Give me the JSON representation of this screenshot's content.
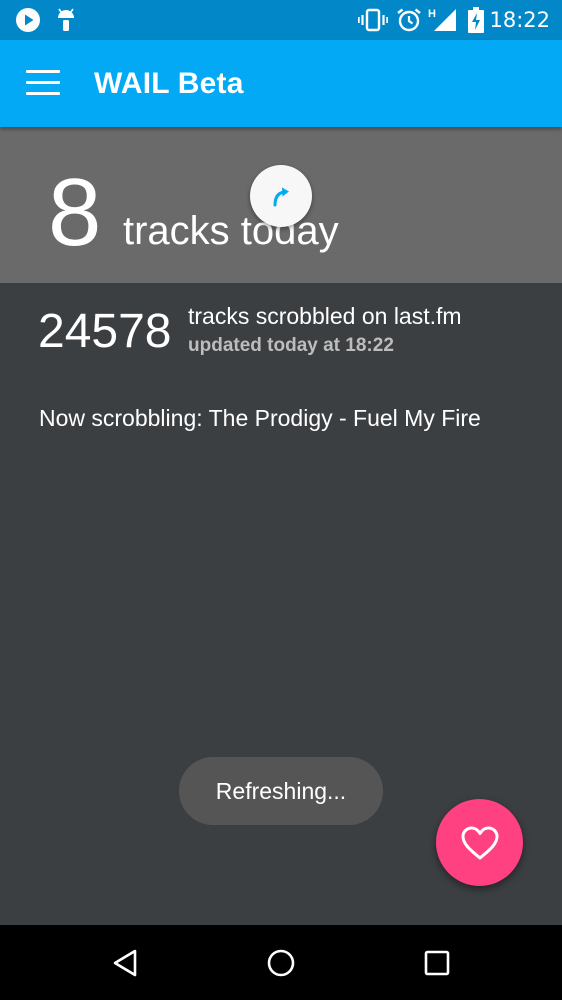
{
  "status_bar": {
    "time": "18:22",
    "icons": [
      "play-notification-icon",
      "android-debug-icon",
      "vibrate-icon",
      "alarm-icon",
      "signal-h-icon",
      "battery-charging-icon"
    ],
    "network_type": "H",
    "background": "#0288c9"
  },
  "app_bar": {
    "title": "WAIL Beta",
    "menu_icon": "hamburger-menu-icon",
    "background": "#03a9f4"
  },
  "today": {
    "count": "8",
    "label": "tracks today"
  },
  "refresh": {
    "icon": "refresh-arrow-icon",
    "color": "#03a9f4"
  },
  "stats": {
    "total": "24578",
    "total_label": "tracks scrobbled on last.fm",
    "updated": "updated today at 18:22"
  },
  "now_scrobbling": "Now scrobbling: The Prodigy - Fuel My Fire",
  "toast": "Refreshing...",
  "fab": {
    "icon": "heart-outline-icon",
    "color": "#ff4081"
  },
  "nav_bar": {
    "buttons": [
      "back-icon",
      "home-icon",
      "recents-icon"
    ]
  }
}
